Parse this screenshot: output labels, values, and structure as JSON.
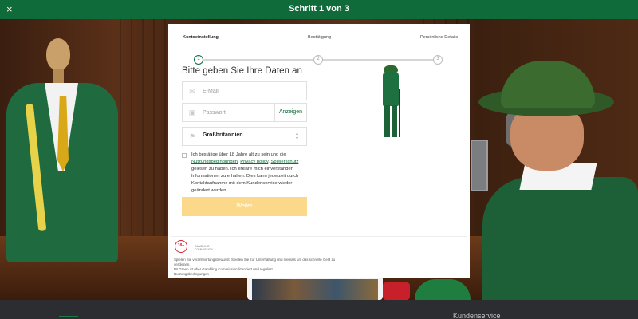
{
  "topbar": {
    "title": "Schritt 1 von 3",
    "close_icon": "×"
  },
  "stepper": {
    "steps": [
      {
        "label": "Kontoeinstellung",
        "number": "1",
        "active": true
      },
      {
        "label": "Bestätigung",
        "number": "2",
        "active": false
      },
      {
        "label": "Persönliche Details",
        "number": "3",
        "active": false
      }
    ]
  },
  "form": {
    "heading": "Bitte geben Sie Ihre Daten an",
    "email": {
      "placeholder": "E-Mail",
      "value": "",
      "icon": "envelope-icon"
    },
    "password": {
      "placeholder": "Passwort",
      "value": "",
      "show_label": "Anzeigen",
      "icon": "lock-icon"
    },
    "country": {
      "value": "Großbritannien",
      "icon": "flag-icon"
    },
    "consent": {
      "text_1": "Ich bestätige über 18 Jahre alt zu sein und die",
      "link_terms": "Nutzungsbedingungen",
      "sep_1": ",",
      "link_privacy": "Privacy policy",
      "sep_2": ",",
      "link_play": "Spielerschutz",
      "text_2": "gelesen zu haben. Ich erkläre mich einverstanden Informationen zu erhalten. Dies kann jederzeit durch Kontaktaufnahme mit dem Kundenservice wieder geändert werden.",
      "checked": false
    },
    "submit_label": "Weiter"
  },
  "badges": {
    "age": "18+",
    "gc_text": "GAMBLING COMMISSION"
  },
  "legal": {
    "line_1": "Spielen Sie verantwortungsbewusst: Spielen Sie zur Unterhaltung und niemals um das schnelle Geld zu verdienen.",
    "line_2": "Mr Green ist über Gambling Commission lizenziert und reguliert.",
    "line_3": "Nutzungsbedingungen"
  },
  "footer": {
    "label": "Kundenservice"
  },
  "colors": {
    "brand_green": "#0f6b3a",
    "button_disabled": "#fcd98a",
    "age_red": "#d8262f"
  }
}
